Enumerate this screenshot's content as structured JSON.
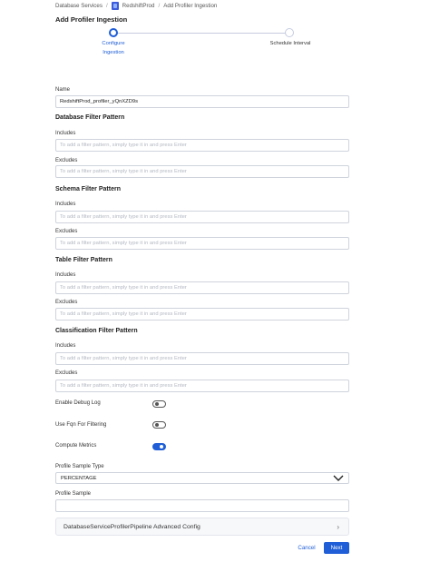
{
  "breadcrumb": {
    "items": [
      "Database Services",
      "RedshiftProd",
      "Add Profiler Ingestion"
    ],
    "separator": "/"
  },
  "page": {
    "title": "Add Profiler Ingestion"
  },
  "stepper": {
    "steps": [
      {
        "label": "Configure Ingestion",
        "status": "active"
      },
      {
        "label": "Schedule Interval",
        "status": "inactive"
      }
    ]
  },
  "form": {
    "name": {
      "label": "Name",
      "value": "RedshiftProd_profiler_yQnXZD9s"
    },
    "placeholder": "To add a filter pattern, simply type it in and press Enter",
    "includes_label": "Includes",
    "excludes_label": "Excludes",
    "sections": {
      "database": "Database Filter Pattern",
      "schema": "Schema Filter Pattern",
      "table": "Table Filter Pattern",
      "classification": "Classification Filter Pattern"
    },
    "toggles": [
      {
        "label": "Enable Debug Log",
        "on": false
      },
      {
        "label": "Use Fqn For Filtering",
        "on": false
      },
      {
        "label": "Compute Metrics",
        "on": true
      }
    ],
    "profile_sample_type": {
      "label": "Profile Sample Type",
      "value": "PERCENTAGE"
    },
    "profile_sample": {
      "label": "Profile Sample",
      "value": ""
    },
    "advanced_config": {
      "label": "DatabaseServiceProfilerPipeline Advanced Config"
    }
  },
  "actions": {
    "cancel": "Cancel",
    "next": "Next"
  },
  "colors": {
    "primary": "#1f5ed6",
    "border": "#cfd3dc"
  }
}
